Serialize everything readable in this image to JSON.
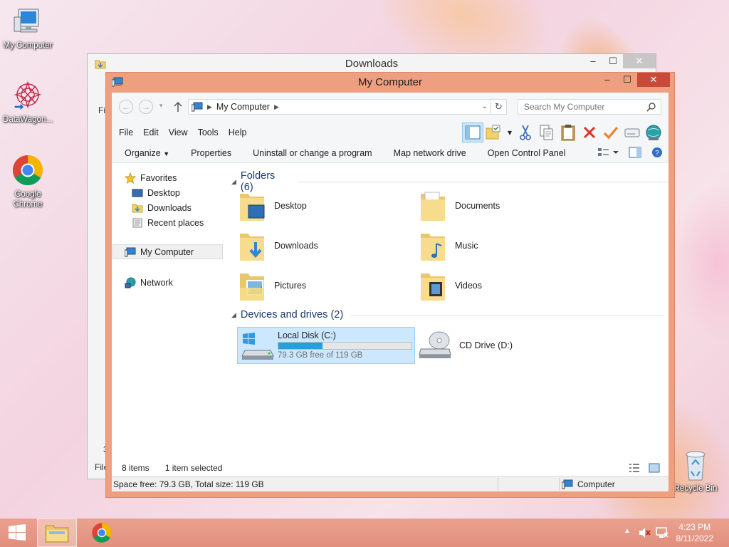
{
  "desktop": {
    "icons": [
      {
        "label": "My Computer",
        "icon": "computer-icon"
      },
      {
        "label": "DataWagon...",
        "icon": "datawagon-icon"
      },
      {
        "label": "Google Chrome",
        "icon": "chrome-icon"
      },
      {
        "label": "Recycle Bin",
        "icon": "recycle-bin-icon"
      }
    ]
  },
  "back_window": {
    "title": "Downloads",
    "fragments": {
      "file_menu": "Fi",
      "status": "File",
      "count": "3"
    }
  },
  "window": {
    "title": "My Computer",
    "controls": {
      "minimize": "–",
      "maximize": "☐",
      "close": "✕"
    },
    "address": {
      "path": "My Computer",
      "history_glyph": "▾",
      "refresh_glyph": "↻"
    },
    "search": {
      "placeholder": "Search My Computer"
    },
    "menu": [
      "File",
      "Edit",
      "View",
      "Tools",
      "Help"
    ],
    "commands": [
      "Organize",
      "Properties",
      "Uninstall or change a program",
      "Map network drive",
      "Open Control Panel"
    ],
    "nav": {
      "favorites": "Favorites",
      "favorites_items": [
        "Desktop",
        "Downloads",
        "Recent places"
      ],
      "my_computer": "My Computer",
      "network": "Network"
    },
    "folders_header": "Folders (6)",
    "folders": [
      "Desktop",
      "Documents",
      "Downloads",
      "Music",
      "Pictures",
      "Videos"
    ],
    "devices_header": "Devices and drives (2)",
    "drives": {
      "local": {
        "name": "Local Disk (C:)",
        "free_text": "79.3 GB free of 119 GB",
        "used_fraction": 0.334
      },
      "cd": {
        "name": "CD Drive (D:)"
      }
    },
    "status": {
      "items": "8 items",
      "selected": "1 item selected",
      "space": "Space free: 79.3 GB, Total size: 119 GB",
      "location": "Computer"
    }
  },
  "taskbar": {
    "time": "4:23 PM",
    "date": "8/11/2022",
    "tray_arrow": "▲"
  },
  "colors": {
    "window_frame": "#ee9f7f",
    "close_button": "#c74a3a",
    "selection": "#cce8ff",
    "drive_bar": "#26a0da"
  }
}
